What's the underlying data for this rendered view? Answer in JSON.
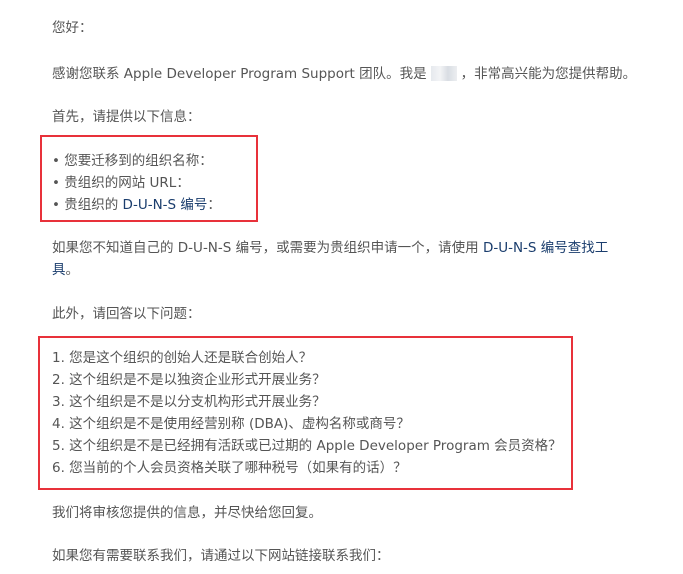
{
  "email": {
    "greeting": "您好：",
    "intro_before": "感谢您联系 Apple Developer Program Support 团队。我是",
    "intro_after": "，非常高兴能为您提供帮助。",
    "first_request": "首先，请提供以下信息：",
    "info_items": [
      "• 您要迁移到的组织名称：",
      "• 贵组织的网站 URL：",
      "• 贵组织的 "
    ],
    "duns_link": "D-U-N-S 编号",
    "info_item3_suffix": "：",
    "duns_note_before": "如果您不知道自己的 D-U-N-S 编号，或需要为贵组织申请一个，请使用 ",
    "duns_tool_link_part1": "D-U-N-S 编号查找工",
    "duns_tool_link_part2": "具",
    "duns_note_end": "。",
    "questions_intro": "此外，请回答以下问题：",
    "questions": [
      "1. 您是这个组织的创始人还是联合创始人？",
      "2. 这个组织是不是以独资企业形式开展业务？",
      "3. 这个组织是不是以分支机构形式开展业务？",
      "4. 这个组织是不是使用经营别称 (DBA)、虚构名称或商号？",
      "5. 这个组织是不是已经拥有活跃或已过期的 Apple Developer Program 会员资格？",
      "6. 您当前的个人会员资格关联了哪种税号（如果有的话）？"
    ],
    "review_note": "我们将审核您提供的信息，并尽快给您回复。",
    "contact_note": "如果您有需要联系我们，请通过以下网站链接联系我们："
  },
  "colors": {
    "text": "#555555",
    "link": "#1a3d6d",
    "highlight_border": "#e8313a"
  }
}
